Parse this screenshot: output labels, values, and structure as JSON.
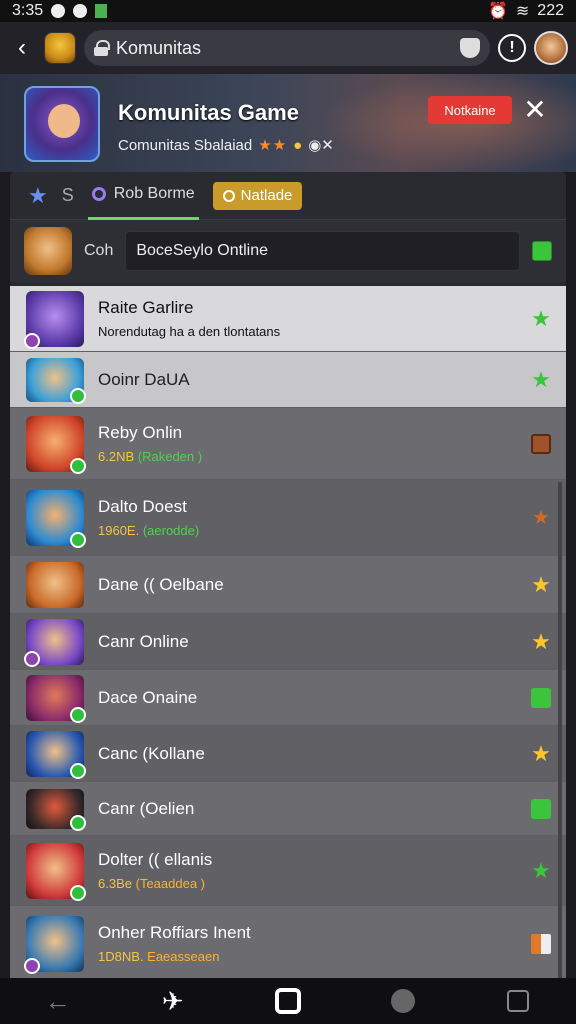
{
  "status_bar": {
    "time": "3:35",
    "battery": "222"
  },
  "browser": {
    "url_text": "Komunitas"
  },
  "header": {
    "title": "Komunitas Game",
    "subtitle": "Comunitas Sbalaiad",
    "rating_stars": "★★",
    "count_text": "◉✕",
    "notif_button": "Notkaine",
    "close_glyph": "✕"
  },
  "tabs": {
    "star_glyph": "★",
    "s_glyph": "S",
    "active_label": "Rob Borme",
    "badge_label": "Natlade"
  },
  "search": {
    "label": "Coh",
    "value": "BoceSeylo Ontline"
  },
  "rows": [
    {
      "name": "Raite Garlire",
      "sub": "Norendutag ha a den tlontatans"
    },
    {
      "name": "Ooinr  DaUA"
    },
    {
      "name": "Reby Onlin",
      "num": "6.2NB",
      "tag": "(Rakeden )"
    },
    {
      "name": "Dalto Doest",
      "num": "1960E.",
      "tag": "(aerodde)"
    },
    {
      "name": "Dane (( Oelbane"
    },
    {
      "name": "Canr Online"
    },
    {
      "name": "Dace Onaine"
    },
    {
      "name": "Canc (Kollane"
    },
    {
      "name": "Canr (Oelien"
    },
    {
      "name": "Dolter (( ellanis",
      "num": "6.3Be",
      "tag": "(Teaaddea )"
    },
    {
      "name": "Onher Roffiars Inent",
      "num": "1D8NB.",
      "tag": "Eaeasseaen"
    }
  ],
  "nav": {
    "back_glyph": "←",
    "plane_glyph": "✈"
  }
}
